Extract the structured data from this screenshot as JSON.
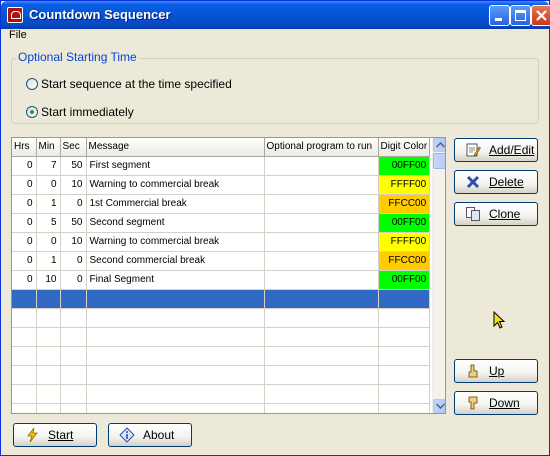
{
  "window": {
    "title": "Countdown Sequencer"
  },
  "menu": {
    "file": "File"
  },
  "starting_time": {
    "legend": "Optional Starting Time",
    "option_specified": "Start sequence at the time specified",
    "option_immediately": "Start immediately",
    "selected": "immediately"
  },
  "grid": {
    "columns": [
      "Hrs",
      "Min",
      "Sec",
      "Message",
      "Optional program to run",
      "Digit Color"
    ],
    "rows": [
      {
        "hrs": "0",
        "min": "7",
        "sec": "50",
        "message": "First segment",
        "program": "",
        "color": "00FF00",
        "bg": "#00ff00"
      },
      {
        "hrs": "0",
        "min": "0",
        "sec": "10",
        "message": "Warning to commercial break",
        "program": "",
        "color": "FFFF00",
        "bg": "#ffff00"
      },
      {
        "hrs": "0",
        "min": "1",
        "sec": "0",
        "message": "1st Commercial break",
        "program": "",
        "color": "FFCC00",
        "bg": "#ffcc00"
      },
      {
        "hrs": "0",
        "min": "5",
        "sec": "50",
        "message": "Second segment",
        "program": "",
        "color": "00FF00",
        "bg": "#00ff00"
      },
      {
        "hrs": "0",
        "min": "0",
        "sec": "10",
        "message": "Warning to commercial break",
        "program": "",
        "color": "FFFF00",
        "bg": "#ffff00"
      },
      {
        "hrs": "0",
        "min": "1",
        "sec": "0",
        "message": "Second commercial break",
        "program": "",
        "color": "FFCC00",
        "bg": "#ffcc00"
      },
      {
        "hrs": "0",
        "min": "10",
        "sec": "0",
        "message": "Final Segment",
        "program": "",
        "color": "00FF00",
        "bg": "#00ff00"
      }
    ],
    "selected_row_color": "#316ac5",
    "empty_rows": 7
  },
  "buttons": {
    "add_edit": "Add/Edit",
    "delete": "Delete",
    "clone": "Clone",
    "up": "Up",
    "down": "Down",
    "start": "Start",
    "about": "About"
  },
  "colors": {
    "title_bar": "#0455d6",
    "legend": "#0046d5",
    "window_bg": "#ece9d8"
  }
}
